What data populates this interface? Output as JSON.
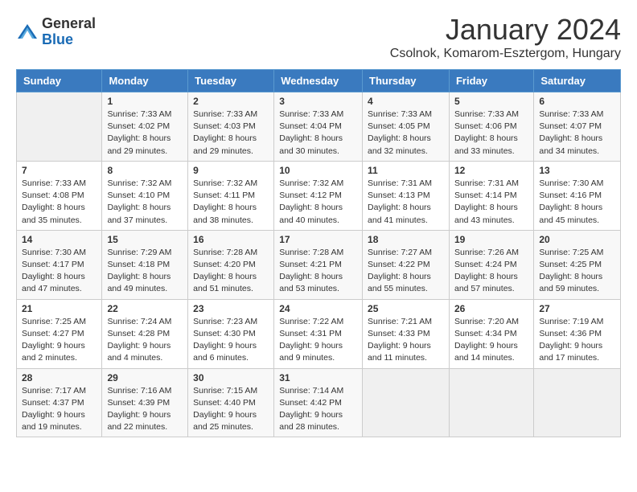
{
  "header": {
    "logo_general": "General",
    "logo_blue": "Blue",
    "month_title": "January 2024",
    "subtitle": "Csolnok, Komarom-Esztergom, Hungary"
  },
  "days_of_week": [
    "Sunday",
    "Monday",
    "Tuesday",
    "Wednesday",
    "Thursday",
    "Friday",
    "Saturday"
  ],
  "weeks": [
    [
      {
        "day": "",
        "info": ""
      },
      {
        "day": "1",
        "info": "Sunrise: 7:33 AM\nSunset: 4:02 PM\nDaylight: 8 hours\nand 29 minutes."
      },
      {
        "day": "2",
        "info": "Sunrise: 7:33 AM\nSunset: 4:03 PM\nDaylight: 8 hours\nand 29 minutes."
      },
      {
        "day": "3",
        "info": "Sunrise: 7:33 AM\nSunset: 4:04 PM\nDaylight: 8 hours\nand 30 minutes."
      },
      {
        "day": "4",
        "info": "Sunrise: 7:33 AM\nSunset: 4:05 PM\nDaylight: 8 hours\nand 32 minutes."
      },
      {
        "day": "5",
        "info": "Sunrise: 7:33 AM\nSunset: 4:06 PM\nDaylight: 8 hours\nand 33 minutes."
      },
      {
        "day": "6",
        "info": "Sunrise: 7:33 AM\nSunset: 4:07 PM\nDaylight: 8 hours\nand 34 minutes."
      }
    ],
    [
      {
        "day": "7",
        "info": "Sunrise: 7:33 AM\nSunset: 4:08 PM\nDaylight: 8 hours\nand 35 minutes."
      },
      {
        "day": "8",
        "info": "Sunrise: 7:32 AM\nSunset: 4:10 PM\nDaylight: 8 hours\nand 37 minutes."
      },
      {
        "day": "9",
        "info": "Sunrise: 7:32 AM\nSunset: 4:11 PM\nDaylight: 8 hours\nand 38 minutes."
      },
      {
        "day": "10",
        "info": "Sunrise: 7:32 AM\nSunset: 4:12 PM\nDaylight: 8 hours\nand 40 minutes."
      },
      {
        "day": "11",
        "info": "Sunrise: 7:31 AM\nSunset: 4:13 PM\nDaylight: 8 hours\nand 41 minutes."
      },
      {
        "day": "12",
        "info": "Sunrise: 7:31 AM\nSunset: 4:14 PM\nDaylight: 8 hours\nand 43 minutes."
      },
      {
        "day": "13",
        "info": "Sunrise: 7:30 AM\nSunset: 4:16 PM\nDaylight: 8 hours\nand 45 minutes."
      }
    ],
    [
      {
        "day": "14",
        "info": "Sunrise: 7:30 AM\nSunset: 4:17 PM\nDaylight: 8 hours\nand 47 minutes."
      },
      {
        "day": "15",
        "info": "Sunrise: 7:29 AM\nSunset: 4:18 PM\nDaylight: 8 hours\nand 49 minutes."
      },
      {
        "day": "16",
        "info": "Sunrise: 7:28 AM\nSunset: 4:20 PM\nDaylight: 8 hours\nand 51 minutes."
      },
      {
        "day": "17",
        "info": "Sunrise: 7:28 AM\nSunset: 4:21 PM\nDaylight: 8 hours\nand 53 minutes."
      },
      {
        "day": "18",
        "info": "Sunrise: 7:27 AM\nSunset: 4:22 PM\nDaylight: 8 hours\nand 55 minutes."
      },
      {
        "day": "19",
        "info": "Sunrise: 7:26 AM\nSunset: 4:24 PM\nDaylight: 8 hours\nand 57 minutes."
      },
      {
        "day": "20",
        "info": "Sunrise: 7:25 AM\nSunset: 4:25 PM\nDaylight: 8 hours\nand 59 minutes."
      }
    ],
    [
      {
        "day": "21",
        "info": "Sunrise: 7:25 AM\nSunset: 4:27 PM\nDaylight: 9 hours\nand 2 minutes."
      },
      {
        "day": "22",
        "info": "Sunrise: 7:24 AM\nSunset: 4:28 PM\nDaylight: 9 hours\nand 4 minutes."
      },
      {
        "day": "23",
        "info": "Sunrise: 7:23 AM\nSunset: 4:30 PM\nDaylight: 9 hours\nand 6 minutes."
      },
      {
        "day": "24",
        "info": "Sunrise: 7:22 AM\nSunset: 4:31 PM\nDaylight: 9 hours\nand 9 minutes."
      },
      {
        "day": "25",
        "info": "Sunrise: 7:21 AM\nSunset: 4:33 PM\nDaylight: 9 hours\nand 11 minutes."
      },
      {
        "day": "26",
        "info": "Sunrise: 7:20 AM\nSunset: 4:34 PM\nDaylight: 9 hours\nand 14 minutes."
      },
      {
        "day": "27",
        "info": "Sunrise: 7:19 AM\nSunset: 4:36 PM\nDaylight: 9 hours\nand 17 minutes."
      }
    ],
    [
      {
        "day": "28",
        "info": "Sunrise: 7:17 AM\nSunset: 4:37 PM\nDaylight: 9 hours\nand 19 minutes."
      },
      {
        "day": "29",
        "info": "Sunrise: 7:16 AM\nSunset: 4:39 PM\nDaylight: 9 hours\nand 22 minutes."
      },
      {
        "day": "30",
        "info": "Sunrise: 7:15 AM\nSunset: 4:40 PM\nDaylight: 9 hours\nand 25 minutes."
      },
      {
        "day": "31",
        "info": "Sunrise: 7:14 AM\nSunset: 4:42 PM\nDaylight: 9 hours\nand 28 minutes."
      },
      {
        "day": "",
        "info": ""
      },
      {
        "day": "",
        "info": ""
      },
      {
        "day": "",
        "info": ""
      }
    ]
  ]
}
